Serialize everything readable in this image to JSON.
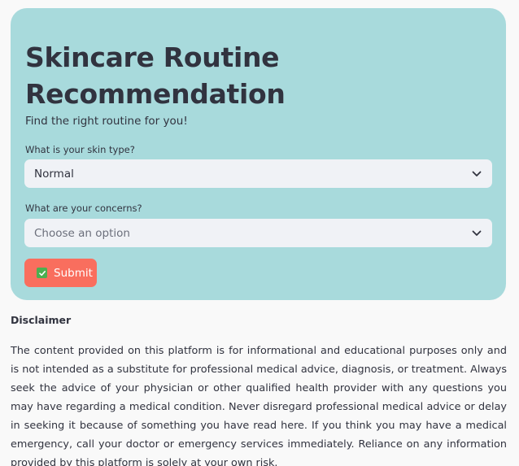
{
  "header": {
    "title": "Skincare Routine Recommendation",
    "subtitle": "Find the right routine for you!"
  },
  "form": {
    "skin_type": {
      "label": "What is your skin type?",
      "selected": "Normal",
      "icon": "chevron-down-icon"
    },
    "concerns": {
      "label": "What are your concerns?",
      "placeholder": "Choose an option",
      "icon": "chevron-down-icon"
    },
    "submit": {
      "label": "Submit",
      "icon": "check-box-icon",
      "color": "#f96e5e"
    }
  },
  "disclaimer": {
    "heading": "Disclaimer",
    "text": "The content provided on this platform is for informational and educational purposes only and is not intended as a substitute for professional medical advice, diagnosis, or treatment. Always seek the advice of your physician or other qualified health provider with any questions you may have regarding a medical condition. Never disregard professional medical advice or delay in seeking it because of something you have read here. If you think you may have a medical emergency, call your doctor or emergency services immediately. Reliance on any information provided by this platform is solely at your own risk."
  },
  "colors": {
    "card_background": "#a8dadc",
    "page_background": "#f9f9f9",
    "input_background": "#f0f2f6",
    "text": "#31333f"
  }
}
